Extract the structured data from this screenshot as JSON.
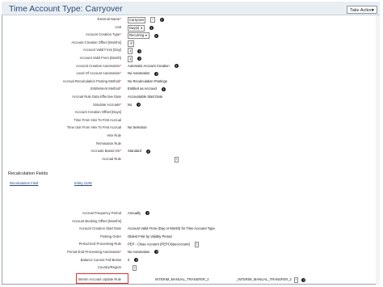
{
  "header": {
    "title": "Time Account Type: Carryover",
    "take_action_label": "Take Action"
  },
  "fields_top": [
    {
      "label": "External Name",
      "required": true,
      "value": "Carryover",
      "boxed": true,
      "help": true,
      "small_icon": true
    },
    {
      "label": "Unit",
      "required": false,
      "value": "Day(s)",
      "boxed": true,
      "dropdown": true,
      "help": true
    },
    {
      "label": "Account Creation Type",
      "required": true,
      "value": "Recurring",
      "boxed": true,
      "dropdown": true,
      "help": true
    },
    {
      "label": "Account Creation Offset [Months]",
      "required": false,
      "value": "-3",
      "boxed": true
    },
    {
      "label": "Account Valid From [Day]",
      "required": false,
      "value": "1",
      "boxed": true,
      "help": true
    },
    {
      "label": "Account Valid From [Month]",
      "required": false,
      "value": "1",
      "boxed": true,
      "help": true
    },
    {
      "label": "Account Creation Automation",
      "required": true,
      "value": "Automatic Account Creation",
      "help": true
    },
    {
      "label": "Level Of Account Automation",
      "required": true,
      "value": "No Automation",
      "help": true
    },
    {
      "label": "Accrual Recalculation Posting Method",
      "required": true,
      "value": "No Recalculation Postings",
      "help": false
    },
    {
      "label": "Entitlement Method",
      "required": true,
      "value": "Entitled as Accrued",
      "help": true
    },
    {
      "label": "Accrual Rule Data Effective Date",
      "required": false,
      "value": "Accountable Start Date",
      "help": false
    },
    {
      "label": "Simulate Accruals",
      "required": true,
      "value": "No",
      "help": true
    },
    {
      "label": "Account Creation Offset [Days]",
      "required": false,
      "value": "",
      "help": false
    },
    {
      "label": "Time From Hire To First Accrual",
      "required": false,
      "value": "",
      "help": false
    },
    {
      "label": "Time Unit From Hire To First Accrual",
      "required": false,
      "value": "No Selection",
      "help": false
    },
    {
      "label": "Hire Rule",
      "required": false,
      "value": "",
      "help": false
    },
    {
      "label": "Termination Rule",
      "required": false,
      "value": "",
      "help": false
    },
    {
      "label": "Accruals Based On",
      "required": true,
      "value": "Standard",
      "help": true
    },
    {
      "label": "Accrual Rule",
      "required": false,
      "value": "",
      "help": false,
      "link_icon": true
    }
  ],
  "recalc_section": {
    "title": "Recalculation Fields",
    "col1": "Recalculation Field",
    "col2": "Entity UUID"
  },
  "fields_bottom": [
    {
      "label": "Accrual Frequency Period",
      "required": false,
      "value": "Annually",
      "help": true
    },
    {
      "label": "Account Booking Offset [Months]",
      "required": false,
      "value": "",
      "help": false
    },
    {
      "label": "Account Creation Start Date",
      "required": false,
      "value": "Account Valid From (Day or Month) for Time Account Type",
      "help": false
    },
    {
      "label": "Posting Order",
      "required": false,
      "value": "Oldest First by Validity Period",
      "help": false
    },
    {
      "label": "Period End Processing Rule",
      "required": false,
      "value": "PEP - Close Account (PEPCloseAccount)",
      "help": false,
      "small_icon": true
    },
    {
      "label": "Period-End Processing Automation",
      "required": true,
      "value": "No Automation",
      "help": true
    },
    {
      "label": "Balance Cannot Fall Below",
      "required": false,
      "value": "0",
      "help": true
    },
    {
      "label": "Country/Region",
      "required": false,
      "value": "",
      "help": false,
      "small_icon": true
    }
  ],
  "interim_row": {
    "label": "Interim Account Update Rule",
    "value": "INTERIM_MANUAL_TRANSFER_2",
    "extra": "_INTERIM_MANUAL_TRANSFER_2"
  },
  "icons": {
    "help": "help-icon",
    "dropdown": "chevron-down-icon",
    "link": "link-icon"
  }
}
